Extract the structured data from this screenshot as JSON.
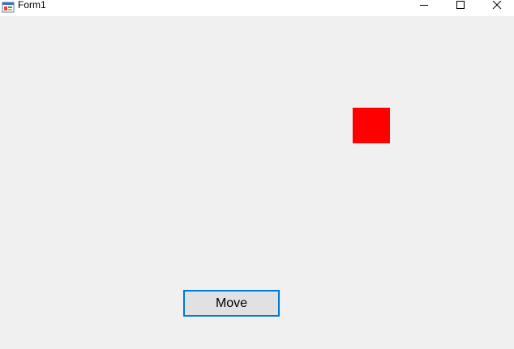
{
  "window": {
    "title": "Form1",
    "icon": "winforms-app-icon"
  },
  "titlebar": {
    "minimize_icon": "minimize-icon",
    "maximize_icon": "maximize-icon",
    "close_icon": "close-icon"
  },
  "form": {
    "box_color": "#ff0000",
    "move_button_label": "Move",
    "button_border_color": "#0078d7"
  }
}
